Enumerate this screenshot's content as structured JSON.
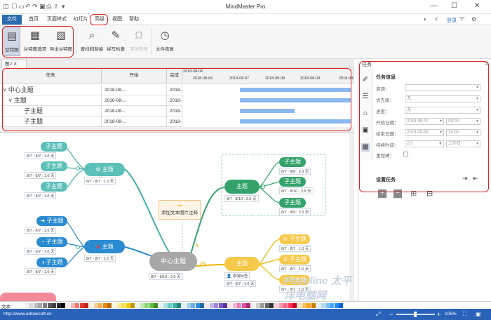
{
  "app": {
    "title": "MindMaster Pro"
  },
  "menu": {
    "tabs": [
      "文件",
      "首页",
      "页面样式",
      "幻灯片",
      "高级",
      "视图",
      "帮助"
    ]
  },
  "titlebar": {
    "login": "登录",
    "skin_icon": "tshirt-icon"
  },
  "ribbon": {
    "buttons": [
      "甘特图",
      "甘特图选项",
      "导出甘特图",
      "查找和替换",
      "拼写检查",
      "字体符号",
      "文件恢复"
    ]
  },
  "doc": {
    "tab": "图2"
  },
  "gantt": {
    "headers": {
      "task": "任务",
      "start": "开始",
      "end": "完成"
    },
    "date_top": "2018-08-06",
    "dates": [
      "2018-08-06",
      "2018-08-07",
      "2018-08-08",
      "2018-08-09",
      "2018-08"
    ],
    "rows": [
      {
        "name": "中心主题",
        "start": "2018-08-...",
        "end": "2018-08-..."
      },
      {
        "name": "主题",
        "start": "2018-08-...",
        "end": "2018-08-..."
      },
      {
        "name": "子主题",
        "start": "2018-08-...",
        "end": "2018-08-..."
      },
      {
        "name": "子主题",
        "start": "2018-08-...",
        "end": "2018-08-..."
      }
    ]
  },
  "mindmap": {
    "center": "中心主题",
    "center_tag": "8/7 - 8/10 : 3.5 天",
    "floating": "添加文本图片注释",
    "left1": {
      "title": "主题",
      "tag": "8/7 - 8/7 : 1.0 天",
      "children": [
        "子主题",
        "子主题",
        "子主题"
      ],
      "tags": [
        "8/7 - 8/7 : 1.0 天",
        "8/7 - 8/7 : 1.0 天",
        "8/7 - 8/7 : 1.0 天"
      ]
    },
    "left2": {
      "title": "主题",
      "tag": "8/7 - 8/7 : 1.0 天",
      "children": [
        "子主题",
        "子主题",
        "子主题"
      ],
      "tags": [
        "8/7 - 8/7 : 1.0 天",
        "8/7 - 8/7 : 1.0 天",
        "8/7 - 8/7 : 1.0 天"
      ]
    },
    "right1": {
      "title": "主题",
      "tag": "8/7 - 8/10 : 3.5 天",
      "children": [
        "子主题",
        "子主题",
        "子主题"
      ],
      "tags": [
        "8/7 - 8/8 : 2.0 天",
        "8/7 - 8/10 : 3.5 天",
        "8/7 - 8/9 : 2.5 天"
      ]
    },
    "right2": {
      "title": "主题",
      "tag": "8/7 - 8/7 : 1.0 天",
      "note": "添加标签",
      "children": [
        "子主题",
        "子主题",
        "子主题"
      ],
      "tags": [
        "8/7 - 8/7 : 1.0 天",
        "8/7 - 8/7 : 1.0 天",
        "8/7 - 8/7 : 1.0 天"
      ]
    }
  },
  "panel": {
    "title": "任务",
    "section1": "任务信息",
    "fields": [
      {
        "label": "资源：",
        "value": ""
      },
      {
        "label": "优先级：",
        "value": "无"
      },
      {
        "label": "进度：",
        "value": "无"
      },
      {
        "label": "开始日期：",
        "value": "2018-08-07",
        "extra": "08:00"
      },
      {
        "label": "结束日期：",
        "value": "2018-08-08",
        "extra": "16:00"
      },
      {
        "label": "持续时间：",
        "value": "2.0",
        "extra": "工作日"
      },
      {
        "label": "里程碑：",
        "value": ""
      }
    ],
    "section2": "设置任务"
  },
  "palette": {
    "label": "文本"
  },
  "status": {
    "url": "http://www.edrawsoft.cn",
    "zoom": "105%"
  },
  "watermark": "Pconline 太平洋电脑网"
}
